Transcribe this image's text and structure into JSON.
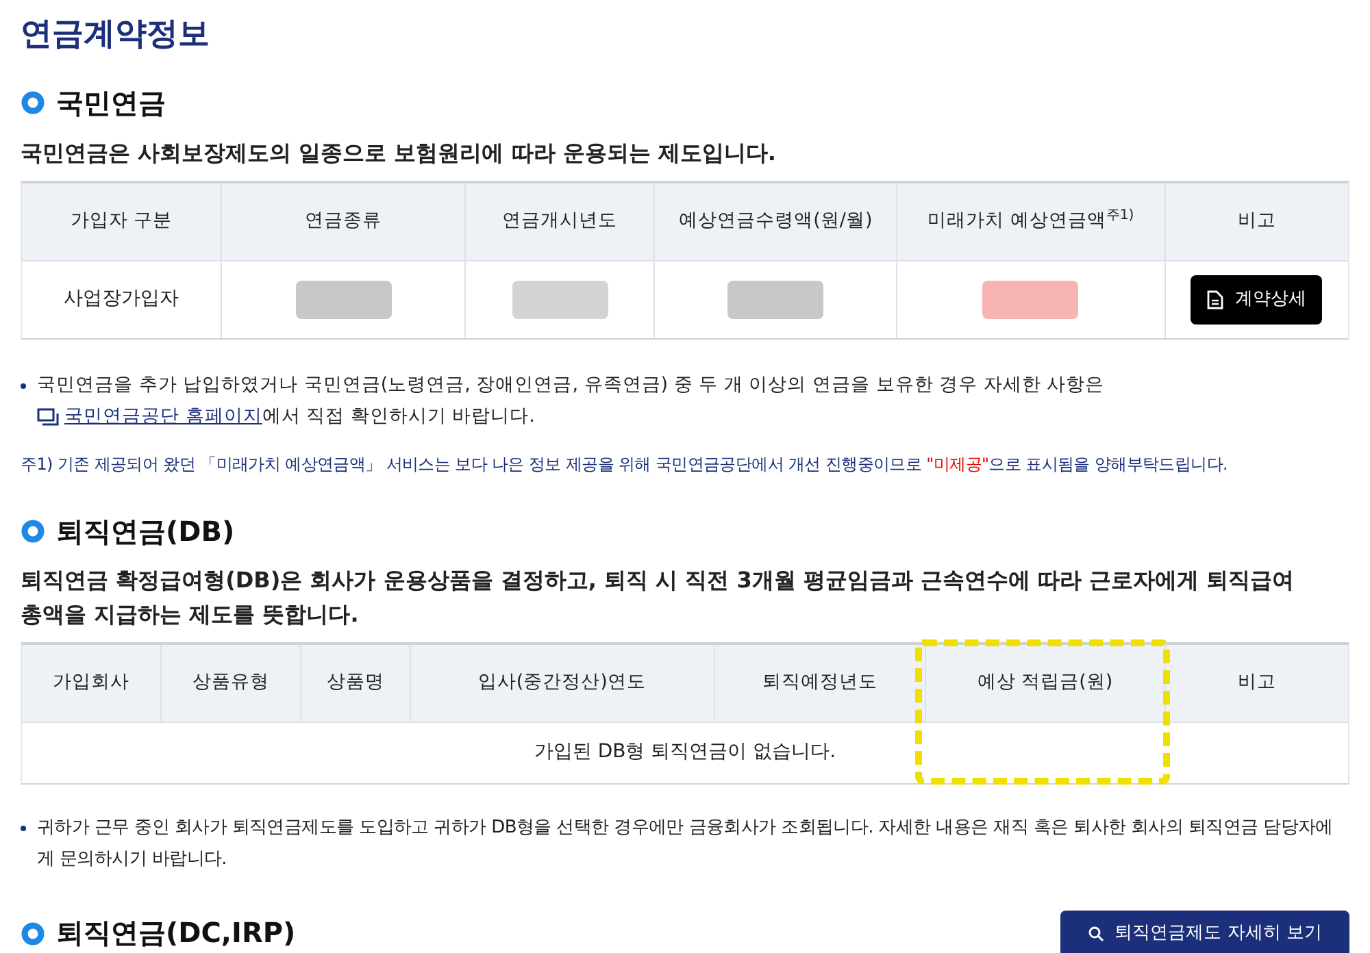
{
  "page_title": "연금계약정보",
  "national_pension": {
    "heading": "국민연금",
    "description": "국민연금은 사회보장제도의 일종으로 보험원리에 따라 운용되는 제도입니다.",
    "table": {
      "columns": [
        {
          "label": "가입자 구분"
        },
        {
          "label": "연금종류"
        },
        {
          "label": "연금개시년도"
        },
        {
          "label": "예상연금수령액(원/월)"
        },
        {
          "label": "미래가치 예상연금액$^{주1)}$"
        },
        {
          "label": "비고"
        }
      ],
      "rows": [
        [
          {
            "kind": "text",
            "text": "사업장가입자"
          },
          {
            "kind": "redacted",
            "color": "#c8c8c8"
          },
          {
            "kind": "redacted",
            "color": "#d4d4d4"
          },
          {
            "kind": "redacted",
            "color": "#c8c8c8"
          },
          {
            "kind": "redacted",
            "color": "#f8b4b4"
          },
          {
            "kind": "button",
            "label": "계약상세"
          }
        ]
      ]
    },
    "notes": [
      {
        "text": "국민연금을 추가 납입하였거나 국민연금(노령연금, 장애인연금, 유족연금) 중 두 개 이상의 연금을 보유한 경우 자세한 사항은",
        "link": "국민연금공단 홈페이지",
        "after": "에서 직접 확인하시기 바랍니다."
      }
    ],
    "footnote": {
      "before": "주1) 기존 제공되어 왔던 「미래가치 예상연금액」 서비스는 보다 나은 정보 제공을 위해 국민연금공단에서 개선 진행중이므로 ",
      "emphasis": "\"미제공\"",
      "after": "으로 표시됨을 양해부탁드립니다."
    }
  },
  "db_pension": {
    "heading": "퇴직연금(DB)",
    "description": "퇴직연금 확정급여형(DB)은 회사가 운용상품을 결정하고, 퇴직 시 직전 3개월 평균임금과 근속연수에 따라 근로자에게 퇴직급여 총액을 지급하는 제도를 뜻합니다.",
    "table": {
      "columns": [
        {
          "label": "가입회사",
          "highlighted": false
        },
        {
          "label": "상품유형",
          "highlighted": false
        },
        {
          "label": "상품명",
          "highlighted": false
        },
        {
          "label": "입사(중간정산)연도",
          "highlighted": false
        },
        {
          "label": "퇴직예정년도",
          "highlighted": false
        },
        {
          "label": "예상 적립금(원)",
          "highlighted": true
        },
        {
          "label": "비고",
          "highlighted": false
        }
      ],
      "empty_message": "가입된 DB형 퇴직연금이 없습니다."
    },
    "notes": [
      "귀하가 근무 중인 회사가 퇴직연금제도를 도입하고 귀하가 DB형을 선택한 경우에만 금융회사가 조회됩니다. 자세한 내용은 재직 혹은 퇴사한 회사의 퇴직연금 담당자에게 문의하시기 바랍니다."
    ]
  },
  "dc_pension": {
    "heading": "퇴직연금(DC,IRP)",
    "button": "퇴직연금제도 자세히 보기"
  }
}
